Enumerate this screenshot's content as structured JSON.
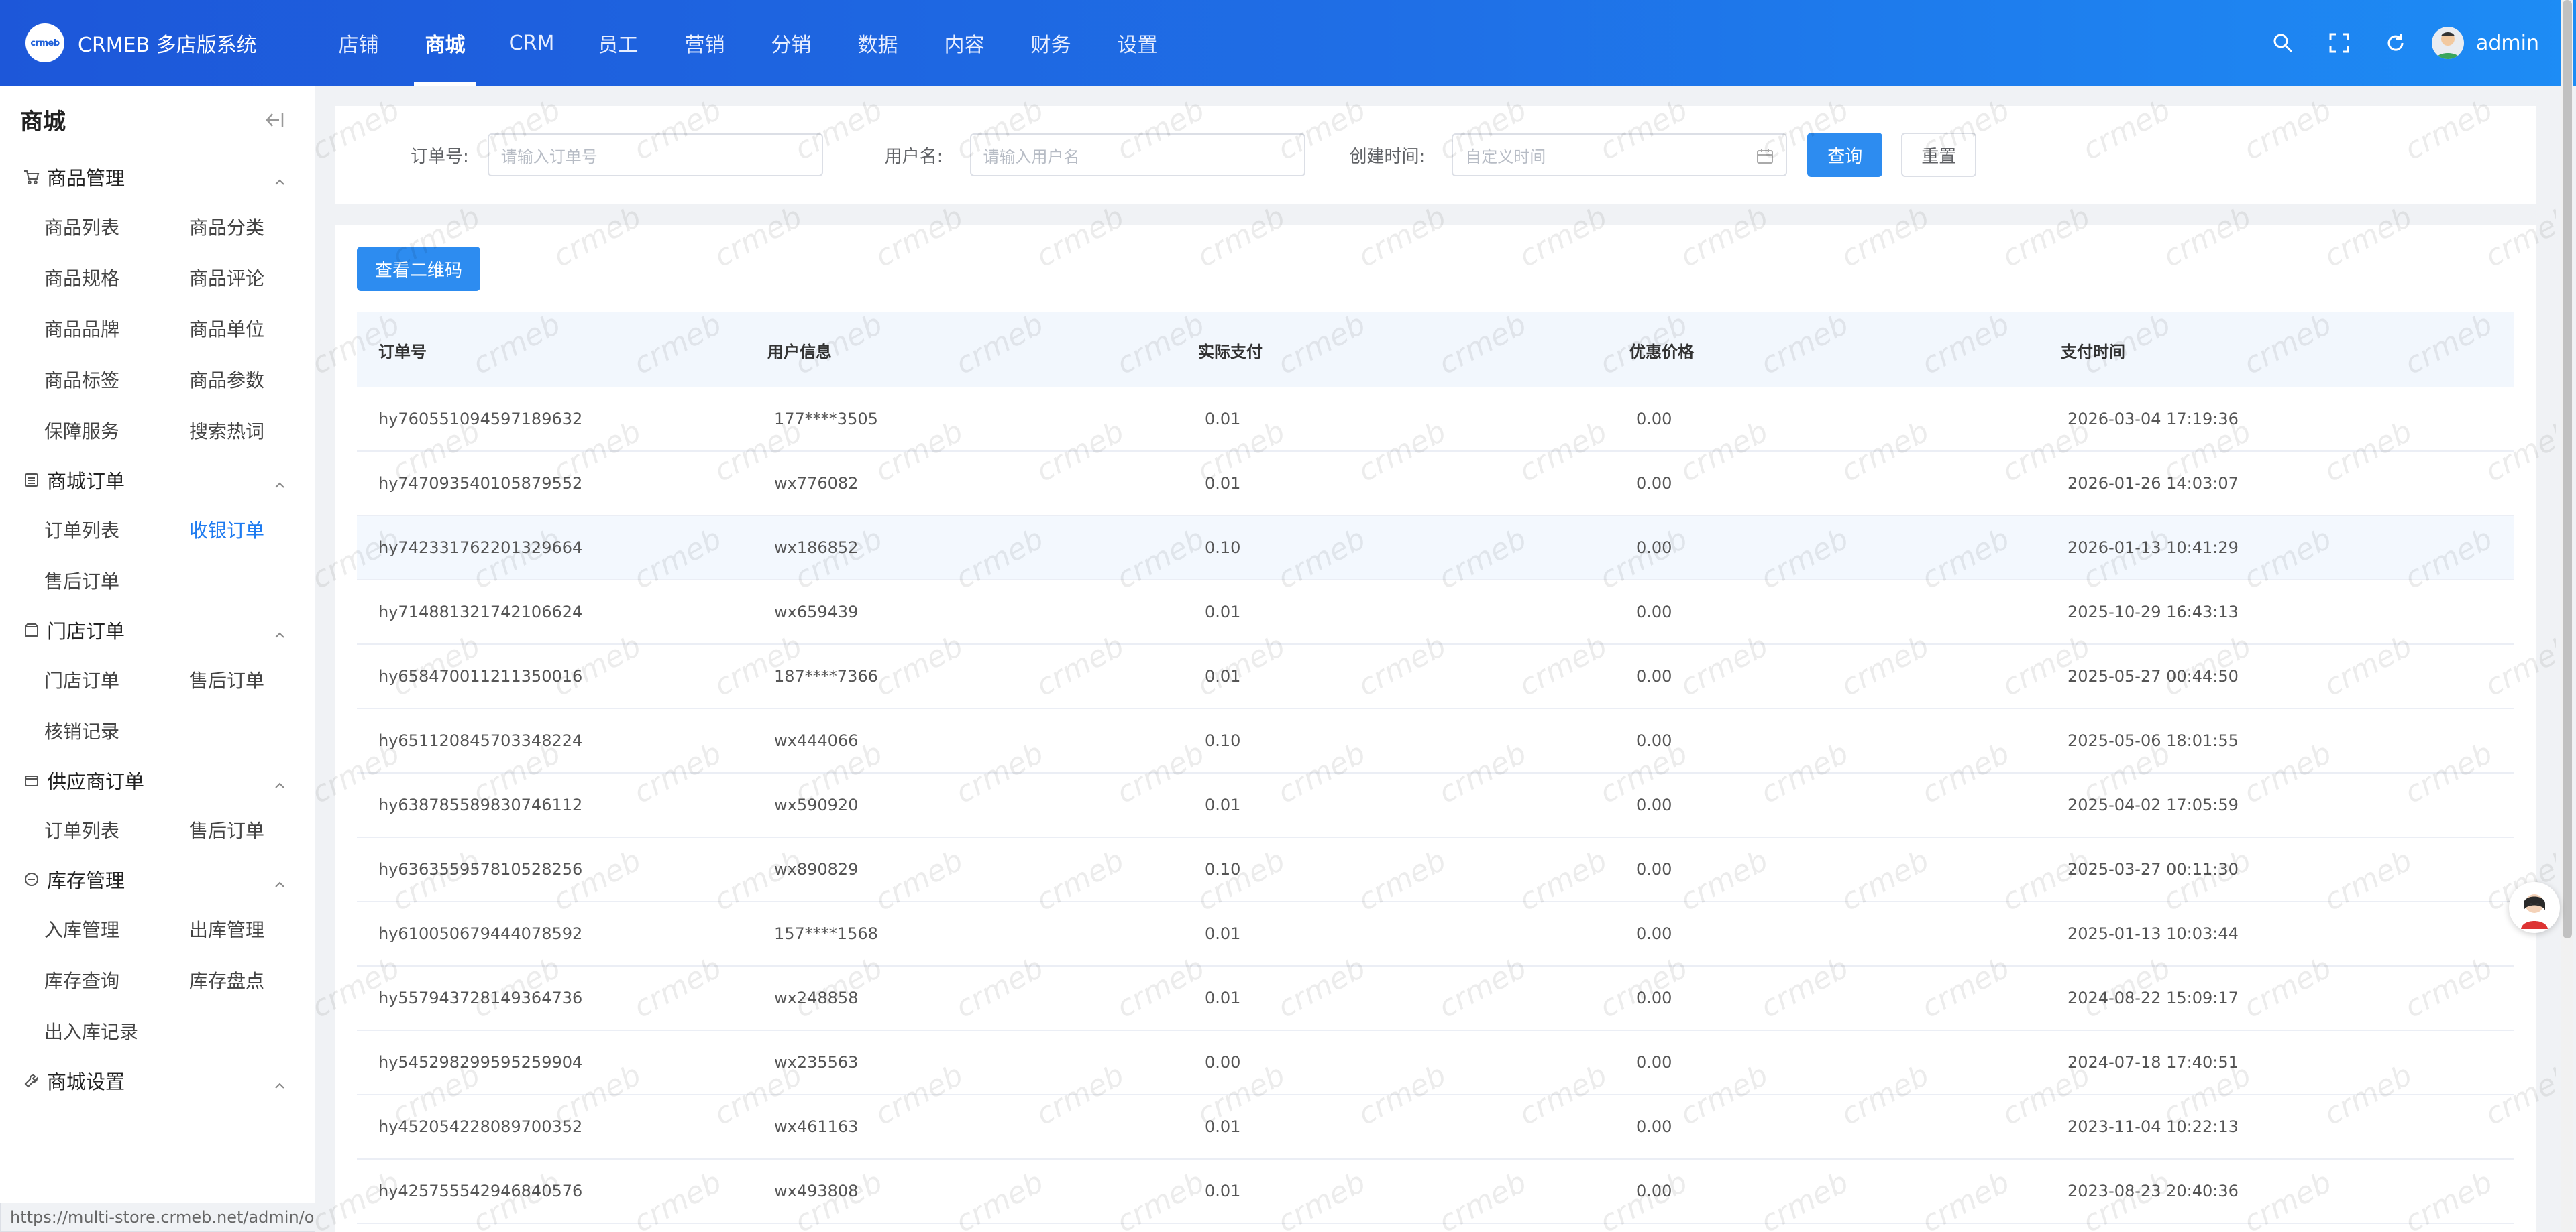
{
  "brand": {
    "logo_text": "crmeb",
    "name": "CRMEB 多店版系统"
  },
  "nav": [
    "店铺",
    "商城",
    "CRM",
    "员工",
    "营销",
    "分销",
    "数据",
    "内容",
    "财务",
    "设置"
  ],
  "nav_active": "商城",
  "user": {
    "name": "admin"
  },
  "sidebar": {
    "title": "商城",
    "groups": [
      {
        "title": "商品管理",
        "icon": "cart-icon",
        "items": [
          "商品列表",
          "商品分类",
          "商品规格",
          "商品评论",
          "商品品牌",
          "商品单位",
          "商品标签",
          "商品参数",
          "保障服务",
          "搜索热词"
        ]
      },
      {
        "title": "商城订单",
        "icon": "list-icon",
        "items": [
          "订单列表",
          "收银订单",
          "售后订单"
        ]
      },
      {
        "title": "门店订单",
        "icon": "store-icon",
        "items": [
          "门店订单",
          "售后订单",
          "核销记录"
        ]
      },
      {
        "title": "供应商订单",
        "icon": "supplier-icon",
        "items": [
          "订单列表",
          "售后订单"
        ]
      },
      {
        "title": "库存管理",
        "icon": "stock-icon",
        "items": [
          "入库管理",
          "出库管理",
          "库存查询",
          "库存盘点",
          "出入库记录"
        ]
      },
      {
        "title": "商城设置",
        "icon": "wrench-icon",
        "items": []
      }
    ],
    "active_item": "收银订单"
  },
  "status_url": "https://multi-store.crmeb.net/admin/order/offline",
  "search": {
    "order_no_label": "订单号:",
    "order_no_placeholder": "请输入订单号",
    "username_label": "用户名:",
    "username_placeholder": "请输入用户名",
    "created_label": "创建时间:",
    "created_placeholder": "自定义时间",
    "query_btn": "查询",
    "reset_btn": "重置"
  },
  "qr_btn": "查看二维码",
  "table": {
    "columns": [
      "订单号",
      "用户信息",
      "实际支付",
      "优惠价格",
      "支付时间"
    ],
    "rows": [
      [
        "hy760551094597189632",
        "177****3505",
        "0.01",
        "0.00",
        "2026-03-04 17:19:36"
      ],
      [
        "hy747093540105879552",
        "wx776082",
        "0.01",
        "0.00",
        "2026-01-26 14:03:07"
      ],
      [
        "hy742331762201329664",
        "wx186852",
        "0.10",
        "0.00",
        "2026-01-13 10:41:29"
      ],
      [
        "hy714881321742106624",
        "wx659439",
        "0.01",
        "0.00",
        "2025-10-29 16:43:13"
      ],
      [
        "hy658470011211350016",
        "187****7366",
        "0.01",
        "0.00",
        "2025-05-27 00:44:50"
      ],
      [
        "hy651120845703348224",
        "wx444066",
        "0.10",
        "0.00",
        "2025-05-06 18:01:55"
      ],
      [
        "hy638785589830746112",
        "wx590920",
        "0.01",
        "0.00",
        "2025-04-02 17:05:59"
      ],
      [
        "hy636355957810528256",
        "wx890829",
        "0.10",
        "0.00",
        "2025-03-27 00:11:30"
      ],
      [
        "hy610050679444078592",
        "157****1568",
        "0.01",
        "0.00",
        "2025-01-13 10:03:44"
      ],
      [
        "hy557943728149364736",
        "wx248858",
        "0.01",
        "0.00",
        "2024-08-22 15:09:17"
      ],
      [
        "hy545298299595259904",
        "wx235563",
        "0.00",
        "0.00",
        "2024-07-18 17:40:51"
      ],
      [
        "hy452054228089700352",
        "wx461163",
        "0.01",
        "0.00",
        "2023-11-04 10:22:13"
      ],
      [
        "hy425755542946840576",
        "wx493808",
        "0.01",
        "0.00",
        "2023-08-23 20:40:36"
      ]
    ],
    "highlight_row": 2
  },
  "watermark_text": "crmeb",
  "colors": {
    "primary": "#2d8cf0",
    "header_from": "#1d57d9",
    "header_to": "#1d8cf5",
    "active_menu": "#1e7bf0"
  }
}
